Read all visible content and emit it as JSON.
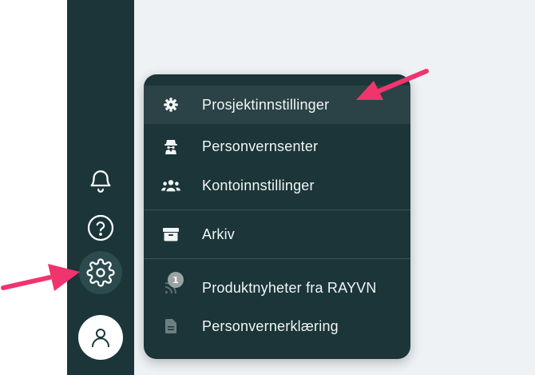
{
  "menu": {
    "items": [
      {
        "label": "Prosjektinnstillinger",
        "icon": "gear-icon"
      },
      {
        "label": "Personvernsenter",
        "icon": "spy-icon"
      },
      {
        "label": "Kontoinnstillinger",
        "icon": "users-icon"
      },
      {
        "label": "Arkiv",
        "icon": "archive-icon"
      },
      {
        "label": "Produktnyheter fra RAYVN",
        "icon": "rss-icon",
        "badge": "1"
      },
      {
        "label": "Personvernerklæring",
        "icon": "document-icon"
      }
    ]
  },
  "sidebar": {
    "icons": [
      "bell-icon",
      "help-icon",
      "settings-icon",
      "user-icon"
    ]
  },
  "colors": {
    "sidebar_bg": "#1b3538",
    "menu_bg": "#1b3538",
    "content_bg": "#eef2f4",
    "arrow": "#f0346e"
  }
}
